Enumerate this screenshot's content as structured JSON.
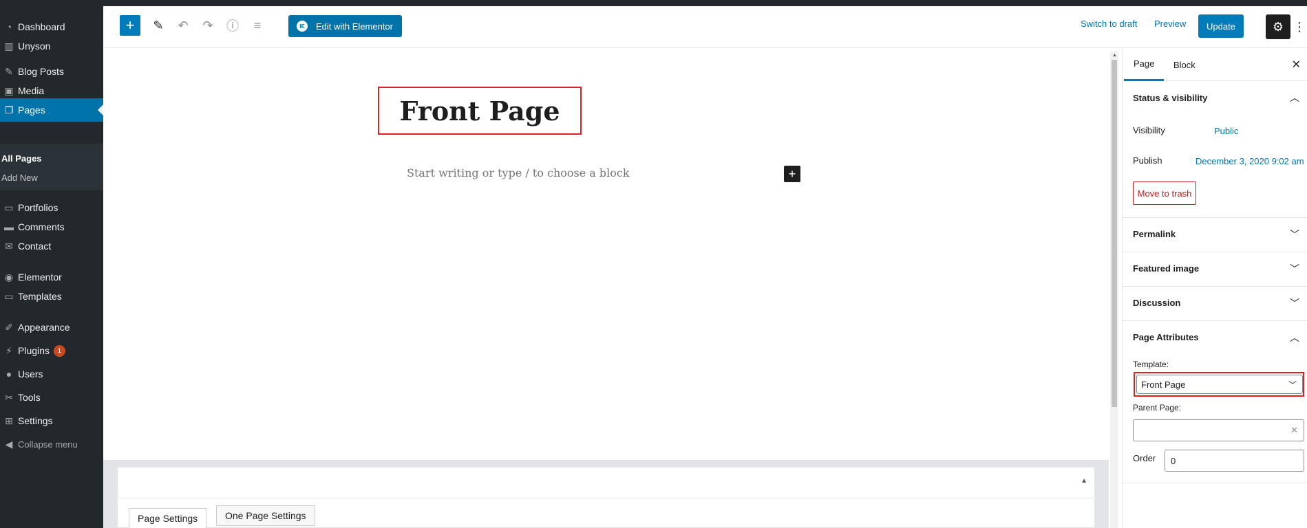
{
  "admin_menu": {
    "items": [
      {
        "label": "Dashboard",
        "icon": "dashboard-icon"
      },
      {
        "label": "Unyson",
        "icon": "unyson-icon"
      },
      {
        "label": "Blog Posts",
        "icon": "pin-icon"
      },
      {
        "label": "Media",
        "icon": "media-icon"
      },
      {
        "label": "Pages",
        "icon": "pages-icon"
      },
      {
        "label": "Portfolios",
        "icon": "folder-icon"
      },
      {
        "label": "Comments",
        "icon": "comments-icon"
      },
      {
        "label": "Contact",
        "icon": "mail-icon"
      },
      {
        "label": "Elementor",
        "icon": "elementor-icon"
      },
      {
        "label": "Templates",
        "icon": "folder-icon"
      },
      {
        "label": "Appearance",
        "icon": "brush-icon"
      },
      {
        "label": "Plugins",
        "icon": "plugin-icon",
        "badge": "1"
      },
      {
        "label": "Users",
        "icon": "users-icon"
      },
      {
        "label": "Tools",
        "icon": "tools-icon"
      },
      {
        "label": "Settings",
        "icon": "settings-icon"
      }
    ],
    "submenu": {
      "all_pages": "All Pages",
      "add_new": "Add New"
    },
    "collapse": "Collapse menu"
  },
  "toolbar": {
    "elementor_label": "Edit with Elementor",
    "switch_to_draft": "Switch to draft",
    "preview": "Preview",
    "update": "Update"
  },
  "editor": {
    "title": "Front Page",
    "placeholder": "Start writing or type / to choose a block"
  },
  "meta_boxes": {
    "tabs": [
      "Page Settings",
      "One Page Settings"
    ]
  },
  "inspector": {
    "tabs": {
      "page": "Page",
      "block": "Block"
    },
    "status": {
      "heading": "Status & visibility",
      "visibility_label": "Visibility",
      "visibility_value": "Public",
      "publish_label": "Publish",
      "publish_value": "December 3, 2020 9:02 am",
      "trash": "Move to trash"
    },
    "panels": {
      "permalink": "Permalink",
      "featured_image": "Featured image",
      "discussion": "Discussion",
      "page_attributes": "Page Attributes"
    },
    "attributes": {
      "template_label": "Template:",
      "template_value": "Front Page",
      "parent_label": "Parent Page:",
      "parent_value": "",
      "order_label": "Order",
      "order_value": "0"
    }
  },
  "colors": {
    "accent": "#007cba",
    "admin_bg": "#23282d",
    "highlight": "#e02020"
  }
}
